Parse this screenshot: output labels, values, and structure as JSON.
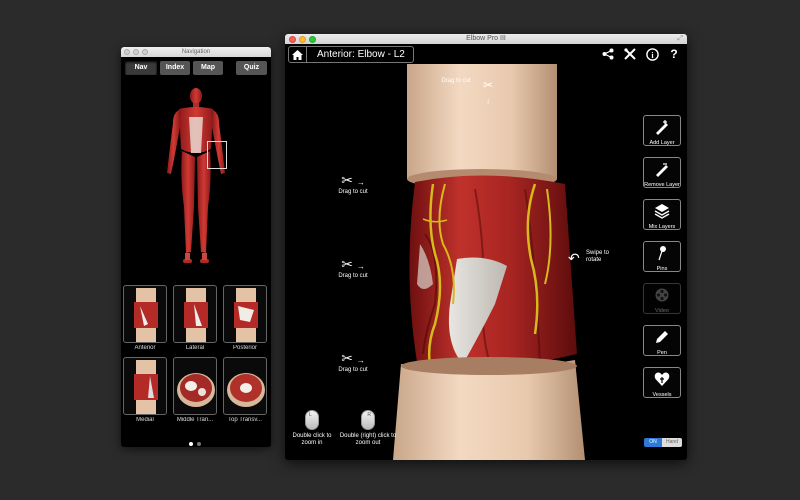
{
  "nav_window": {
    "title": "Navigation",
    "tabs": [
      {
        "label": "Nav",
        "active": true
      },
      {
        "label": "Index",
        "active": false
      },
      {
        "label": "Map",
        "active": false
      },
      {
        "label": "Quiz",
        "active": false
      }
    ],
    "thumbnails": [
      {
        "label": "Anterior"
      },
      {
        "label": "Lateral"
      },
      {
        "label": "Posterior"
      },
      {
        "label": "Medial"
      },
      {
        "label": "Middle Tran..."
      },
      {
        "label": "Top Transv..."
      }
    ]
  },
  "main_window": {
    "title": "Elbow Pro III",
    "breadcrumb": "Anterior: Elbow - L2",
    "icons": [
      "share-icon",
      "tools-icon",
      "info-icon",
      "help-icon"
    ],
    "help_glyph": "?",
    "info_glyph": "i",
    "hints": {
      "drag_top": "Drag to cut",
      "drag_1": "Drag to cut",
      "drag_2": "Drag to cut",
      "drag_3": "Drag to cut",
      "swipe": "Swipe to rotate",
      "double_click": "Double click to zoom in",
      "double_right_click": "Double (right) click to zoom out"
    },
    "mouse_left": "L",
    "mouse_right": "R",
    "tools": [
      {
        "label": "Add Layer",
        "icon": "add-layer-icon",
        "enabled": true
      },
      {
        "label": "Remove Layer",
        "icon": "remove-layer-icon",
        "enabled": true
      },
      {
        "label": "Mix Layers",
        "icon": "layers-icon",
        "enabled": true
      },
      {
        "label": "Pins",
        "icon": "pin-icon",
        "enabled": true
      },
      {
        "label": "Video",
        "icon": "video-reel-icon",
        "enabled": false
      },
      {
        "label": "Pen",
        "icon": "pen-icon",
        "enabled": true
      },
      {
        "label": "Vessels",
        "icon": "vessels-heart-icon",
        "enabled": true
      }
    ],
    "toggle": {
      "on_label": "ON",
      "off_label": "Hand"
    }
  }
}
